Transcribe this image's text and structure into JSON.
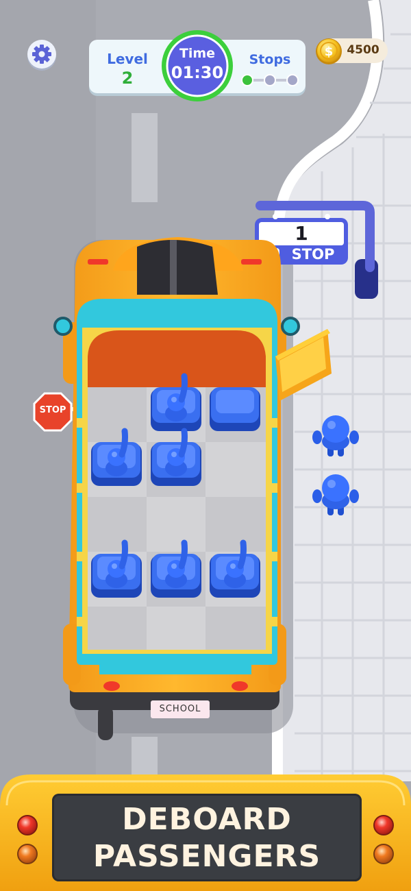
{
  "hud": {
    "level_label": "Level",
    "level_value": "2",
    "time_label": "Time",
    "time_value": "01:30",
    "stops_label": "Stops",
    "stops_progress": {
      "completed": 1,
      "total": 3
    },
    "coins": "4500"
  },
  "bus": {
    "plate_text": "SCHOOL",
    "side_sign_text": "STOP",
    "seats": [
      {
        "row": 1,
        "col": 2,
        "occupied": true
      },
      {
        "row": 1,
        "col": 3,
        "occupied": false
      },
      {
        "row": 2,
        "col": 1,
        "occupied": true
      },
      {
        "row": 2,
        "col": 2,
        "occupied": true
      },
      {
        "row": 4,
        "col": 1,
        "occupied": true
      },
      {
        "row": 4,
        "col": 2,
        "occupied": true
      },
      {
        "row": 4,
        "col": 3,
        "occupied": true
      }
    ]
  },
  "bus_stop": {
    "number": "1",
    "label": "STOP"
  },
  "waiting_passengers": 2,
  "action_button": {
    "line1": "DEBOARD",
    "line2": "PASSENGERS"
  },
  "colors": {
    "accent_blue": "#3f6be0",
    "timer_ring": "#3ccf3c",
    "timer_fill": "#5a5fe0",
    "bus_yellow": "#f7a31c",
    "bus_cyan": "#32c8dd",
    "passenger_blue": "#2f62e8",
    "button_frame": "#f6b624",
    "button_panel": "#3a3d42"
  }
}
